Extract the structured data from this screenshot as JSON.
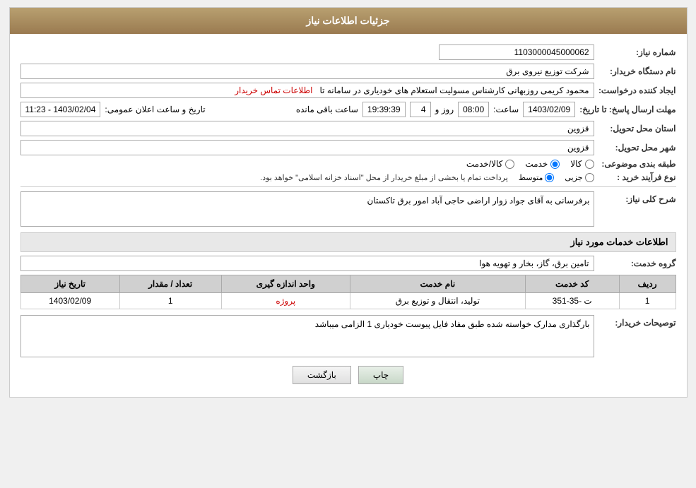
{
  "page": {
    "title": "جزئیات اطلاعات نیاز"
  },
  "header": {
    "shomar_label": "شماره نیاز:",
    "shomar_value": "1103000045000062",
    "nam_dastgah_label": "نام دستگاه خریدار:",
    "nam_dastgah_value": "شرکت توزیع نیروی برق",
    "ejad_label": "ایجاد کننده درخواست:",
    "ejad_value": "محمود کریمی روزبهانی کارشناس  مسولیت استعلام های خودیاری در سامانه تا",
    "contact_link": "اطلاعات تماس خریدار",
    "mohlet_label": "مهلت ارسال پاسخ: تا تاریخ:",
    "date_value": "1403/02/09",
    "time_label": "ساعت:",
    "time_value": "08:00",
    "roz_label": "روز و",
    "roz_value": "4",
    "remaining_label": "ساعت باقی مانده",
    "remaining_value": "19:39:39",
    "elan_label": "تاریخ و ساعت اعلان عمومی:",
    "elan_value": "1403/02/04 - 11:23",
    "ostan_label": "استان محل تحویل:",
    "ostan_value": "قزوین",
    "shahr_label": "شهر محل تحویل:",
    "shahr_value": "قزوین",
    "tabaqe_label": "طبقه بندی موضوعی:",
    "tabaqe_kala": "کالا",
    "tabaqe_khadamat": "خدمت",
    "tabaqe_kala_khadamat": "کالا/خدمت",
    "tabaqe_selected": "خدمت",
    "purchase_label": "نوع فرآیند خرید :",
    "purchase_jezvi": "جزیی",
    "purchase_motovaset": "متوسط",
    "purchase_desc": "پرداخت تمام یا بخشی از مبلغ خریدار از محل \"اسناد خزانه اسلامی\" خواهد بود.",
    "purchase_selected": "متوسط"
  },
  "sharh": {
    "label": "شرح کلی نیاز:",
    "value": "برفرسانی به آقای جواد زوار اراضی حاجی آباد امور برق تاکستان"
  },
  "khadamat": {
    "section_title": "اطلاعات خدمات مورد نیاز",
    "grouh_label": "گروه خدمت:",
    "grouh_value": "تامین برق، گاز، بخار و تهویه هوا",
    "table": {
      "headers": [
        "ردیف",
        "کد خدمت",
        "نام خدمت",
        "واحد اندازه گیری",
        "تعداد / مقدار",
        "تاریخ نیاز"
      ],
      "rows": [
        {
          "radif": "1",
          "code": "ت -35-351",
          "name": "تولید، انتقال و توزیع برق",
          "unit": "پروژه",
          "count": "1",
          "date": "1403/02/09"
        }
      ]
    }
  },
  "toseeh": {
    "label": "توصیحات خریدار:",
    "value": "بارگذاری مدارک خواسته شده طبق مفاد فایل پیوست خودیاری 1 الزامی میباشد"
  },
  "buttons": {
    "print": "چاپ",
    "back": "بازگشت"
  }
}
